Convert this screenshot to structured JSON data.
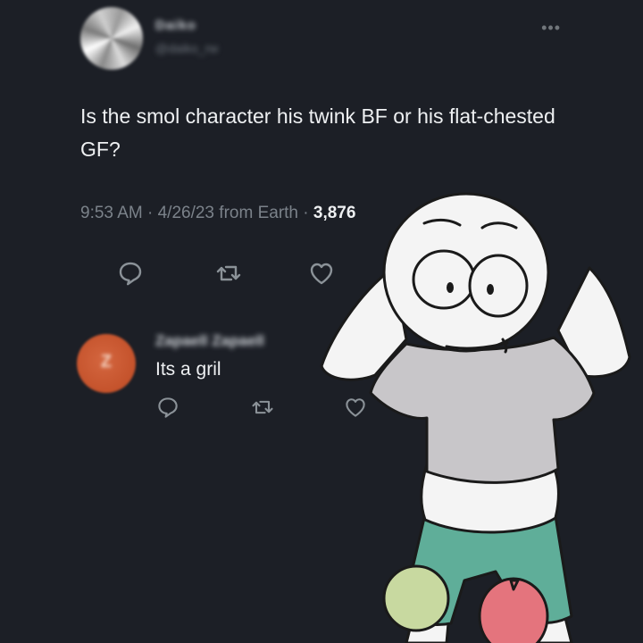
{
  "tweet": {
    "author_name": "Daiko",
    "author_handle": "@daiko_rw",
    "more_icon": "more-horizontal-icon",
    "text": "Is the smol character his twink BF or his flat-chested GF?",
    "time": "9:53 AM",
    "date": "4/26/23",
    "source": "from Earth",
    "views": "3,876",
    "actions": [
      "reply-icon",
      "retweet-icon",
      "like-icon"
    ]
  },
  "reply": {
    "avatar_letter": "Z",
    "author_name": "Zapaell Zapaell",
    "text": "Its a gril",
    "actions": [
      "reply-icon",
      "retweet-icon",
      "like-icon"
    ]
  },
  "colors": {
    "background": "#1c1f26",
    "text": "#eef0f2",
    "muted": "#7b828a",
    "avatar_reply": "#c4522b",
    "shirt": "#c8c6c9",
    "shorts": "#5fae99"
  }
}
